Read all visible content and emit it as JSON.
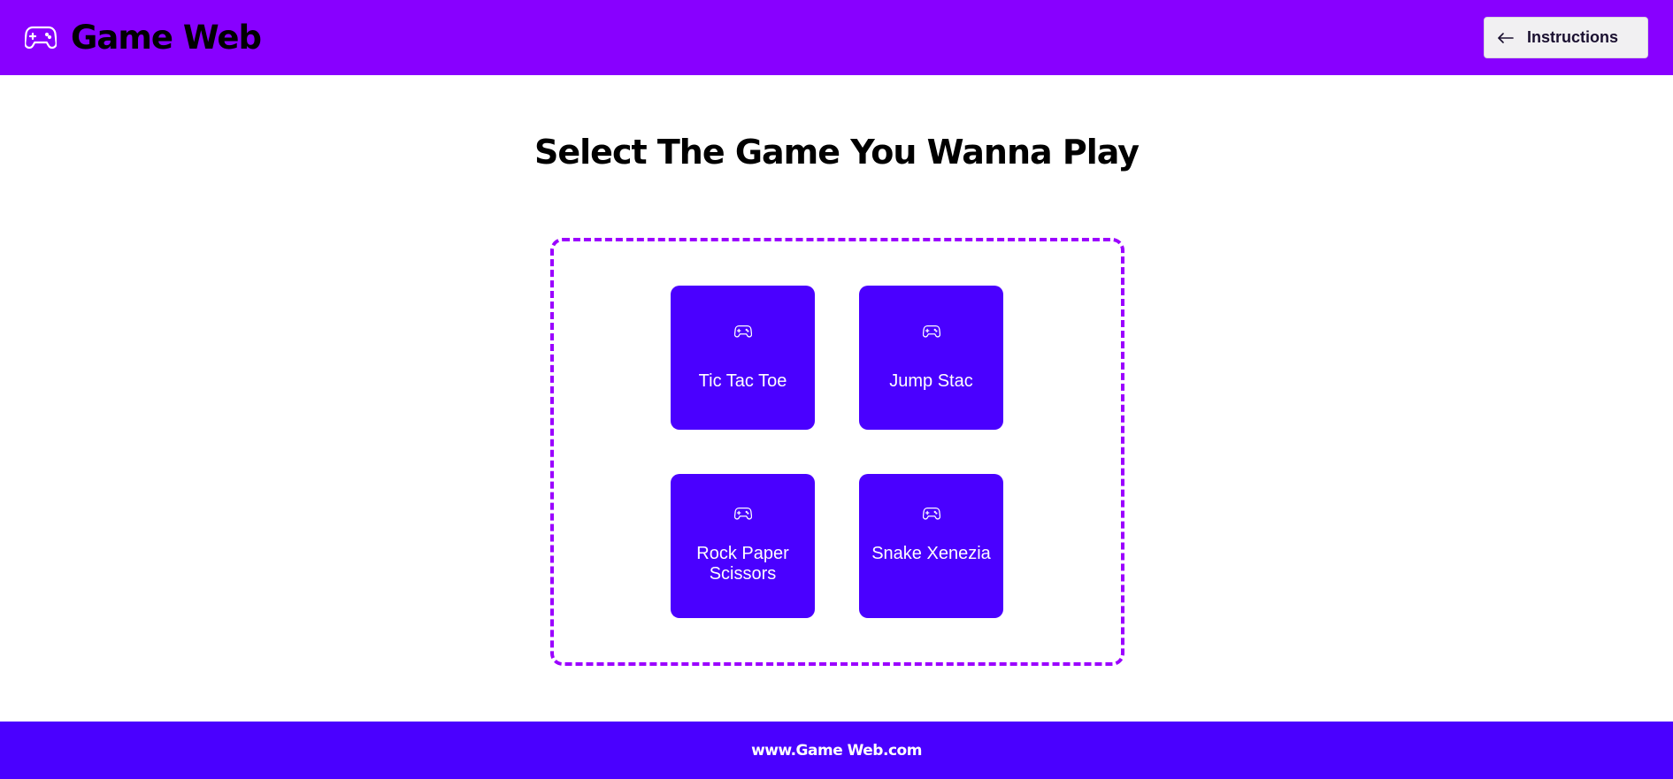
{
  "header": {
    "logo_icon": "gamepad-icon",
    "title": "Game Web",
    "instructions_button": {
      "icon": "arrow-left-icon",
      "label": "Instructions"
    }
  },
  "main": {
    "heading": "Select The Game You Wanna Play",
    "games": [
      {
        "icon": "gamepad-icon",
        "label": "Tic Tac Toe"
      },
      {
        "icon": "gamepad-icon",
        "label": "Jump Stac"
      },
      {
        "icon": "gamepad-icon",
        "label": "Rock Paper Scissors"
      },
      {
        "icon": "gamepad-icon",
        "label": "Snake Xenezia"
      }
    ]
  },
  "footer": {
    "text": "www.Game Web.com"
  },
  "colors": {
    "header_bg": "#8800ff",
    "card_bg": "#4a00ff",
    "footer_bg": "#4a00ff",
    "dashed_border": "#9b00ff"
  }
}
